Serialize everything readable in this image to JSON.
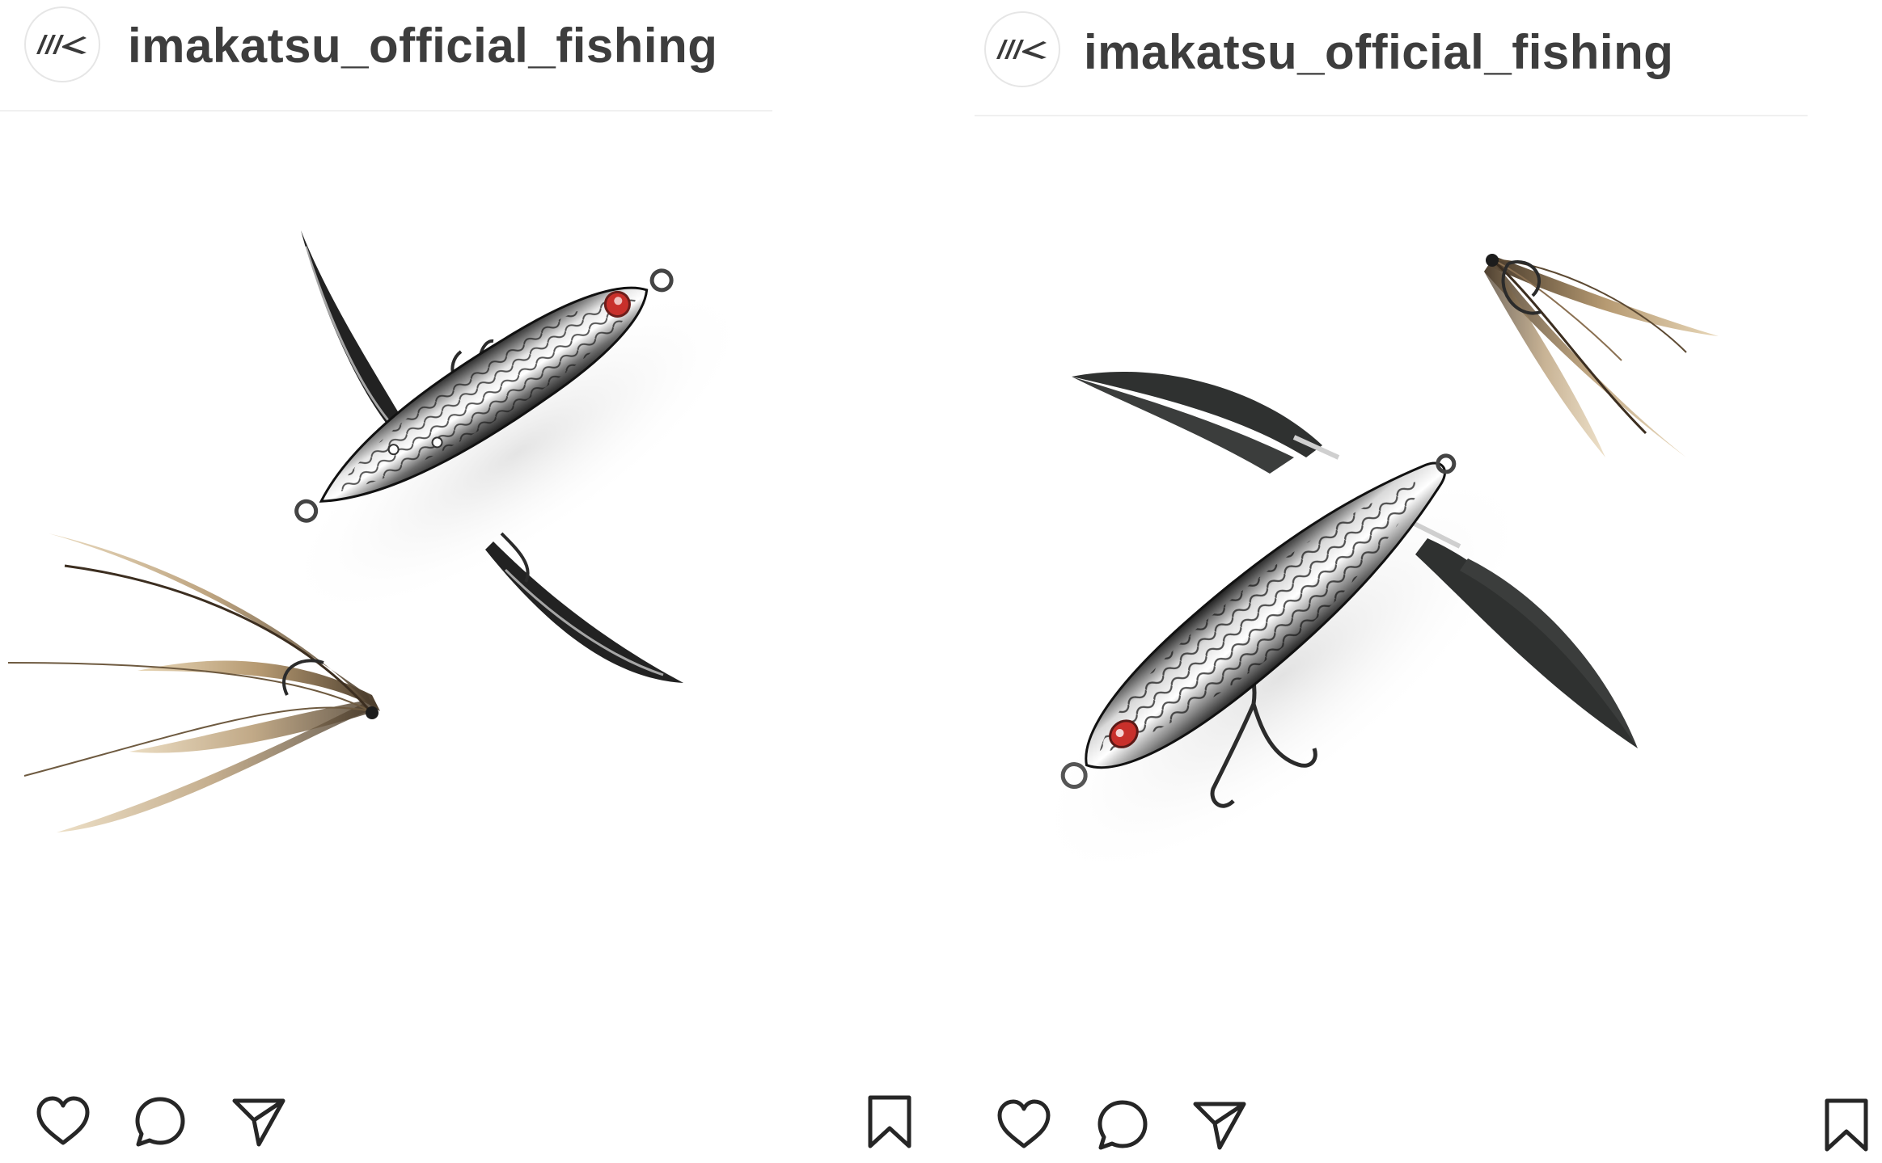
{
  "posts": [
    {
      "username": "imakatsu_official_fishing",
      "avatar_icon": "imakatsu-logo-icon",
      "actions": {
        "like_icon": "heart-icon",
        "comment_icon": "comment-icon",
        "share_icon": "send-icon",
        "save_icon": "bookmark-icon"
      }
    },
    {
      "username": "imakatsu_official_fishing",
      "avatar_icon": "imakatsu-logo-icon",
      "actions": {
        "like_icon": "heart-icon",
        "comment_icon": "comment-icon",
        "share_icon": "send-icon",
        "save_icon": "bookmark-icon"
      }
    }
  ],
  "colors": {
    "username": "#3d3d3d",
    "icon_stroke": "#262626",
    "eye_red": "#c8302b",
    "body_chrome": "#9aa0a6",
    "blade_dark": "#2e302f",
    "feather": "#b69a72"
  }
}
